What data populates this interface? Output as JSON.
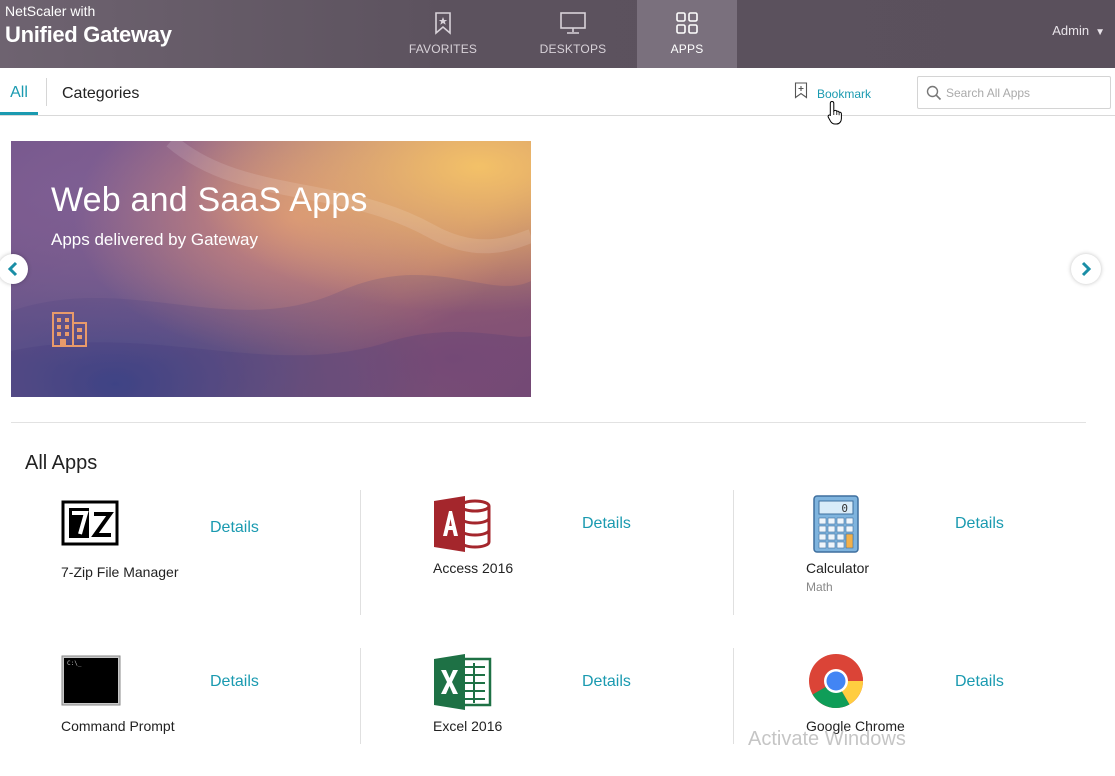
{
  "header": {
    "brand_line1": "NetScaler with",
    "brand_line2": "Unified Gateway",
    "nav": [
      {
        "label": "FAVORITES",
        "icon": "bookmark-icon"
      },
      {
        "label": "DESKTOPS",
        "icon": "monitor-icon"
      },
      {
        "label": "APPS",
        "icon": "grid-icon",
        "active": true
      }
    ],
    "user": "Admin"
  },
  "subnav": {
    "tabs": [
      {
        "label": "All",
        "active": true
      },
      {
        "label": "Categories"
      }
    ],
    "bookmark_label": "Bookmark",
    "search_placeholder": "Search All Apps",
    "search_value": ""
  },
  "banner": {
    "title": "Web and SaaS Apps",
    "subtitle": "Apps delivered by Gateway",
    "icon": "building-icon"
  },
  "section": {
    "title": "All Apps"
  },
  "apps": [
    {
      "name": "7-Zip File Manager",
      "category": "",
      "details": "Details",
      "icon": "7zip-icon"
    },
    {
      "name": "Access 2016",
      "category": "",
      "details": "Details",
      "icon": "access-icon"
    },
    {
      "name": "Calculator",
      "category": "Math",
      "details": "Details",
      "icon": "calculator-icon"
    },
    {
      "name": "Command Prompt",
      "category": "",
      "details": "Details",
      "icon": "command-prompt-icon"
    },
    {
      "name": "Excel 2016",
      "category": "",
      "details": "Details",
      "icon": "excel-icon"
    },
    {
      "name": "Google Chrome",
      "category": "",
      "details": "Details",
      "icon": "chrome-icon"
    }
  ],
  "overlay": {
    "watermark": "Activate Windows"
  },
  "colors": {
    "header_bg": "#5c525e",
    "accent": "#1a9ab0"
  }
}
